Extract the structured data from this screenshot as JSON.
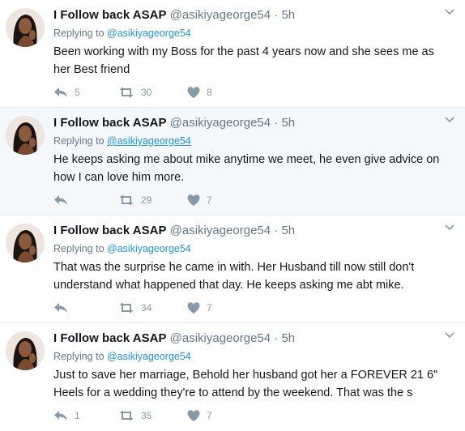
{
  "tweets": [
    {
      "name": "I Follow back ASAP",
      "handle": "@asikiyageorge54",
      "separator": "·",
      "time": "5h",
      "replying_prefix": "Replying to",
      "replying_to": "@asikiyageorge54",
      "text": "Been working with my Boss for the past 4 years now and she sees me as her Best friend",
      "replies": "5",
      "retweets": "30",
      "likes": "8"
    },
    {
      "name": "I Follow back ASAP",
      "handle": "@asikiyageorge54",
      "separator": "·",
      "time": "5h",
      "replying_prefix": "Replying to",
      "replying_to": "@asikiyageorge54",
      "text": "He keeps asking me about mike anytime we meet, he even give advice on how I can love him more.",
      "replies": "",
      "retweets": "29",
      "likes": "7"
    },
    {
      "name": "I Follow back ASAP",
      "handle": "@asikiyageorge54",
      "separator": "·",
      "time": "5h",
      "replying_prefix": "Replying to",
      "replying_to": "@asikiyageorge54",
      "text": "That was the surprise he came in with. Her Husband till now still don't understand what happened that day. He keeps asking me abt mike.",
      "replies": "",
      "retweets": "34",
      "likes": "7"
    },
    {
      "name": "I Follow back ASAP",
      "handle": "@asikiyageorge54",
      "separator": "·",
      "time": "5h",
      "replying_prefix": "Replying to",
      "replying_to": "@asikiyageorge54",
      "text": "Just to save her marriage, Behold her husband got her a FOREVER 21 6\" Heels for a wedding they're to attend by the weekend. That was the s",
      "replies": "1",
      "retweets": "35",
      "likes": "7"
    }
  ],
  "icons": {
    "reply": "reply-icon",
    "retweet": "retweet-icon",
    "like": "heart-icon",
    "caret": "chevron-down-icon"
  },
  "colors": {
    "link": "#1b95e0",
    "muted": "#657786",
    "action": "#8899a6",
    "highlight_bg": "#f5f8fa"
  }
}
